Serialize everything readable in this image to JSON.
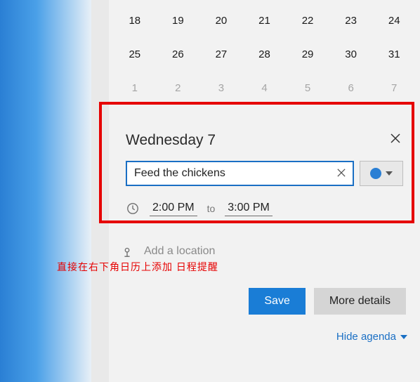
{
  "calendar": {
    "rows": [
      {
        "days": [
          "18",
          "19",
          "20",
          "21",
          "22",
          "23",
          "24"
        ],
        "faded": false
      },
      {
        "days": [
          "25",
          "26",
          "27",
          "28",
          "29",
          "30",
          "31"
        ],
        "faded": false
      },
      {
        "days": [
          "1",
          "2",
          "3",
          "4",
          "5",
          "6",
          "7"
        ],
        "faded": true
      }
    ]
  },
  "event": {
    "day_title": "Wednesday 7",
    "name_value": "Feed the chickens",
    "color": "#2a7fd4",
    "start_time": "2:00 PM",
    "to_label": "to",
    "end_time": "3:00 PM",
    "location_placeholder": "Add a location"
  },
  "annotation": {
    "text": "直接在右下角日历上添加 日程提醒"
  },
  "buttons": {
    "save": "Save",
    "details": "More details"
  },
  "links": {
    "hide_agenda": "Hide agenda"
  }
}
